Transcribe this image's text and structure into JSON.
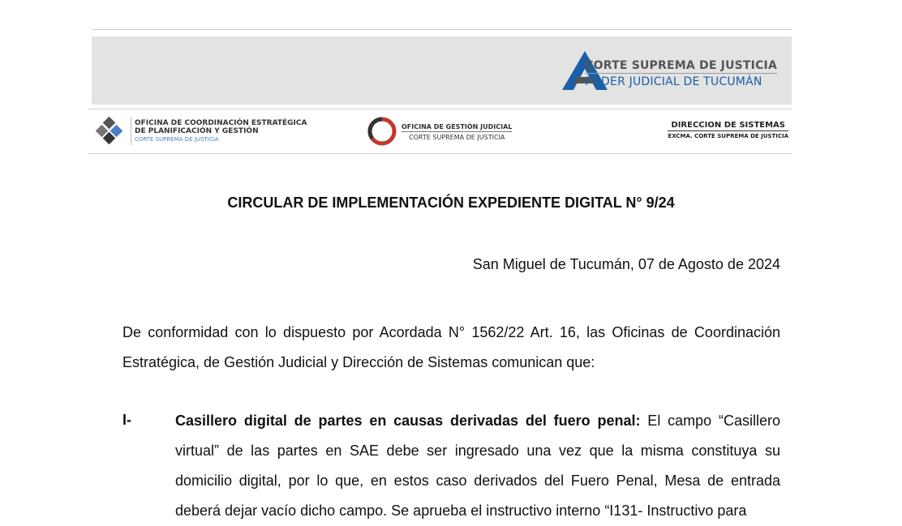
{
  "header": {
    "court_name": "CORTE SUPREMA DE JUSTICIA",
    "judiciary_name": "PODER JUDICIAL DE TUCUMÁN",
    "colors": {
      "banner_bg": "#e3e3e3",
      "brand_blue": "#1a5fa8",
      "brand_red": "#c0392b"
    },
    "offices": [
      {
        "line1": "OFICINA DE COORDINACIÓN ESTRATÉGICA",
        "line2": "DE PLANIFICACIÓN Y GESTIÓN",
        "line3": "CORTE SUPREMA DE JUSTICIA"
      },
      {
        "line1": "OFICINA DE GESTIÓN JUDICIAL",
        "line2": "CORTE SUPREMA DE JUSTICIA"
      },
      {
        "line1": "DIRECCION DE SISTEMAS",
        "line2": "EXCMA. CORTE SUPREMA DE JUSTICIA"
      }
    ]
  },
  "document": {
    "title": "CIRCULAR DE IMPLEMENTACIÓN EXPEDIENTE DIGITAL N° 9/24",
    "place_date": "San Miguel de Tucumán,  07 de Agosto de 2024",
    "intro": "De conformidad con lo dispuesto por Acordada N° 1562/22 Art. 16, las Oficinas de Coordinación Estratégica, de Gestión Judicial y Dirección de Sistemas comunican que:",
    "items": [
      {
        "number": "I-",
        "heading": "Casillero digital de partes en causas derivadas del fuero penal:",
        "text": " El campo “Casillero virtual” de las partes en SAE debe ser ingresado una vez que la misma constituya su domicilio digital, por lo que, en estos caso derivados del Fuero Penal, Mesa de entrada deberá dejar vacío dicho campo. Se aprueba el instructivo interno “I131- Instructivo para"
      }
    ]
  }
}
